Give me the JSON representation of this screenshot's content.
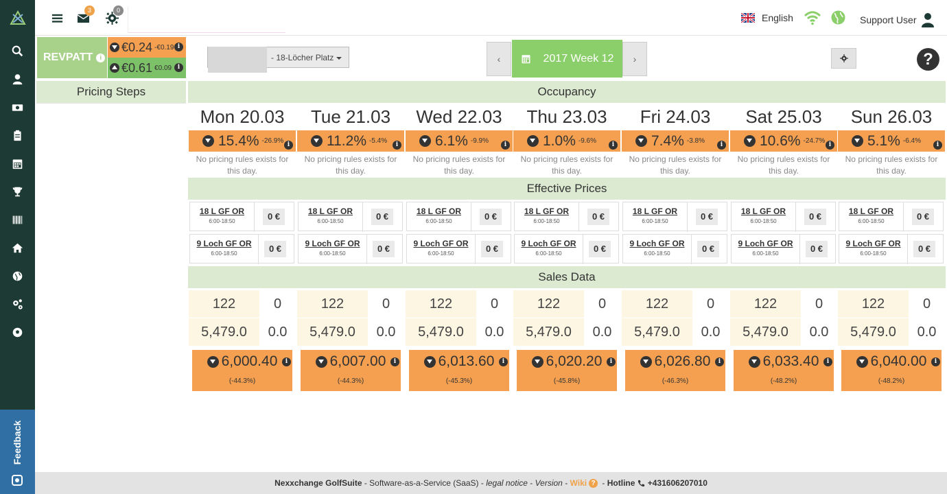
{
  "topbar": {
    "mail_count": "3",
    "settings_count": "0",
    "language": "English",
    "user": "Support User"
  },
  "sidebar": {
    "icons": [
      "search-icon",
      "user-icon",
      "money-icon",
      "clipboard-icon",
      "calendar-icon",
      "trophy-icon",
      "barcode-icon",
      "home-icon",
      "globe-icon",
      "cogs-icon",
      "soccer-icon"
    ],
    "feedback": "Feedback"
  },
  "revpatt": {
    "label": "REVPATT",
    "row1": {
      "value": "€0.24",
      "delta": "-€0.19"
    },
    "row2": {
      "value": "€0.61",
      "delta": "€0.09"
    }
  },
  "course": {
    "label": "- 18-Löcher Platz"
  },
  "week": {
    "label": "2017 Week 12",
    "prev": "‹",
    "next": "›"
  },
  "sections": {
    "pricing_steps": "Pricing Steps",
    "occupancy": "Occupancy",
    "effective_prices": "Effective Prices",
    "sales_data": "Sales Data"
  },
  "no_rules_text": "No pricing rules exists for this day.",
  "days": [
    {
      "name": "Mon 20.03",
      "occ": "15.4%",
      "occ_delta": "-26.9%",
      "p1": "0 €",
      "p2": "0 €",
      "s1a": "122",
      "s1b": "0",
      "s2a": "5,479.0",
      "s2b": "0.0",
      "rev": "6,000.40",
      "rev_pct": "(-44.3%)"
    },
    {
      "name": "Tue 21.03",
      "occ": "11.2%",
      "occ_delta": "-5.4%",
      "p1": "0 €",
      "p2": "0 €",
      "s1a": "122",
      "s1b": "0",
      "s2a": "5,479.0",
      "s2b": "0.0",
      "rev": "6,007.00",
      "rev_pct": "(-44.3%)"
    },
    {
      "name": "Wed 22.03",
      "occ": "6.1%",
      "occ_delta": "-9.9%",
      "p1": "0 €",
      "p2": "0 €",
      "s1a": "122",
      "s1b": "0",
      "s2a": "5,479.0",
      "s2b": "0.0",
      "rev": "6,013.60",
      "rev_pct": "(-45.3%)"
    },
    {
      "name": "Thu 23.03",
      "occ": "1.0%",
      "occ_delta": "-9.6%",
      "p1": "0 €",
      "p2": "0 €",
      "s1a": "122",
      "s1b": "0",
      "s2a": "5,479.0",
      "s2b": "0.0",
      "rev": "6,020.20",
      "rev_pct": "(-45.8%)"
    },
    {
      "name": "Fri 24.03",
      "occ": "7.4%",
      "occ_delta": "-3.8%",
      "p1": "0 €",
      "p2": "0 €",
      "s1a": "122",
      "s1b": "0",
      "s2a": "5,479.0",
      "s2b": "0.0",
      "rev": "6,026.80",
      "rev_pct": "(-46.3%)"
    },
    {
      "name": "Sat 25.03",
      "occ": "10.6%",
      "occ_delta": "-24.7%",
      "p1": "0 €",
      "p2": "0 €",
      "s1a": "122",
      "s1b": "0",
      "s2a": "5,479.0",
      "s2b": "0.0",
      "rev": "6,033.40",
      "rev_pct": "(-48.2%)"
    },
    {
      "name": "Sun 26.03",
      "occ": "5.1%",
      "occ_delta": "-6.4%",
      "p1": "0 €",
      "p2": "0 €",
      "s1a": "122",
      "s1b": "0",
      "s2a": "5,479.0",
      "s2b": "0.0",
      "rev": "6,040.00",
      "rev_pct": "(-48.2%)"
    }
  ],
  "price_items": [
    {
      "name": "18 L GF OR",
      "time": "6:00-18:50"
    },
    {
      "name": "9 Loch GF OR",
      "time": "6:00-18:50"
    }
  ],
  "footer": {
    "brand": "Nexxchange GolfSuite",
    "saas": " - Software-as-a-Service (SaaS) - ",
    "legal": "legal notice",
    "sep1": " - ",
    "version": "Version",
    "sep2": " - ",
    "wiki": "Wiki",
    "sep3": " - ",
    "hotline": "Hotline",
    "phone": " +431606207010"
  },
  "colors": {
    "sidebar": "#1e3a34",
    "accent_orange": "#f4a050",
    "accent_green": "#8bcf6a",
    "section_bg": "#dcead1"
  }
}
